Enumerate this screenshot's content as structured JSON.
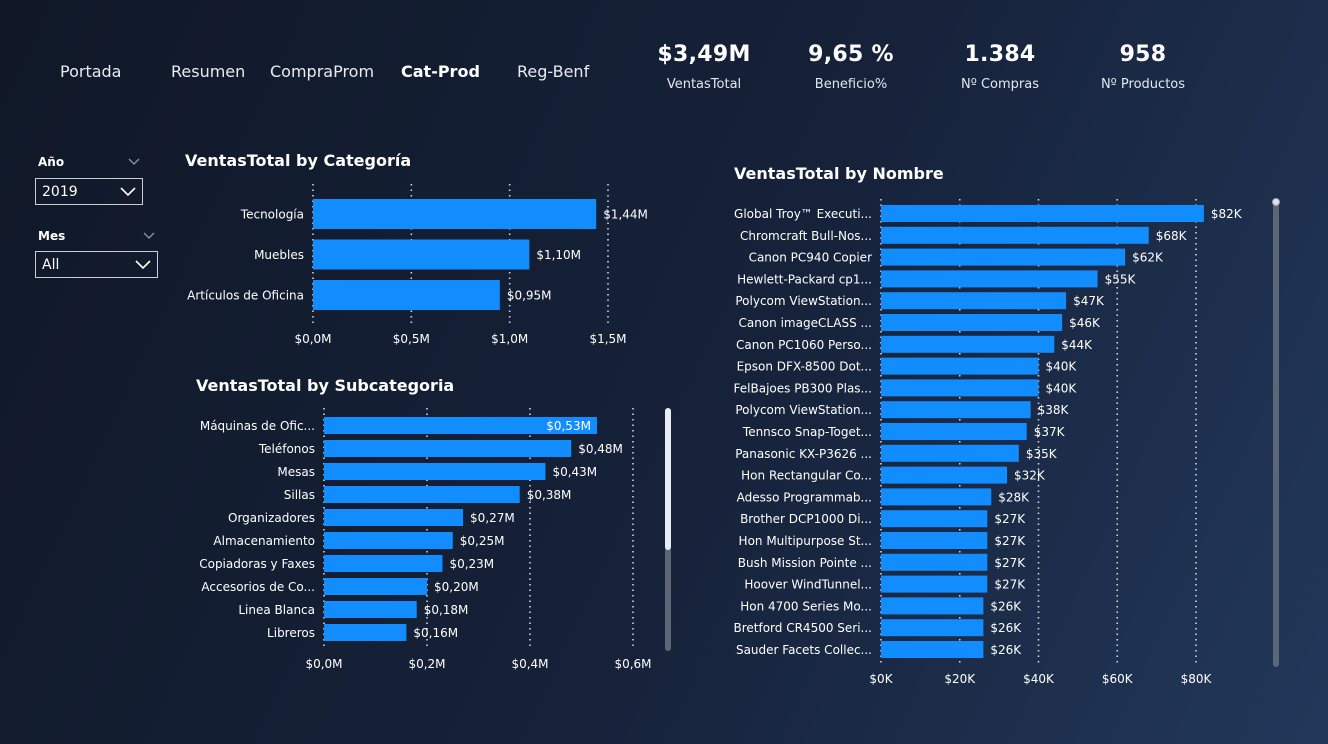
{
  "nav": {
    "items": [
      {
        "label": "Portada",
        "active": false
      },
      {
        "label": "Resumen",
        "active": false
      },
      {
        "label": "CompraProm",
        "active": false
      },
      {
        "label": "Cat-Prod",
        "active": true
      },
      {
        "label": "Reg-Benf",
        "active": false
      }
    ]
  },
  "kpis": [
    {
      "value": "$3,49M",
      "label": "VentasTotal"
    },
    {
      "value": "9,65 %",
      "label": "Beneficio%"
    },
    {
      "value": "1.384",
      "label": "Nº Compras"
    },
    {
      "value": "958",
      "label": "Nº Productos"
    }
  ],
  "slicers": {
    "year": {
      "title": "Año",
      "selected": "2019",
      "icon": "chevron-down-icon"
    },
    "month": {
      "title": "Mes",
      "selected": "All",
      "icon": "chevron-down-icon"
    }
  },
  "colors": {
    "bar": "#118dff",
    "grid": "#cfd6df",
    "text": "#ffffff"
  },
  "chart_data": [
    {
      "type": "bar",
      "orientation": "horizontal",
      "title": "VentasTotal by Categoría",
      "categories": [
        "Tecnología",
        "Muebles",
        "Artículos de Oficina"
      ],
      "values": [
        1.44,
        1.1,
        0.95
      ],
      "value_labels": [
        "$1,44M",
        "$1,10M",
        "$0,95M"
      ],
      "xlim": [
        0,
        1.5
      ],
      "x_ticks": [
        0,
        0.5,
        1.0,
        1.5
      ],
      "x_tick_labels": [
        "$0,0M",
        "$0,5M",
        "$1,0M",
        "$1,5M"
      ],
      "unit": "M"
    },
    {
      "type": "bar",
      "orientation": "horizontal",
      "title": "VentasTotal by Subcategoria",
      "categories": [
        "Máquinas de Ofic...",
        "Teléfonos",
        "Mesas",
        "Sillas",
        "Organizadores",
        "Almacenamiento",
        "Copiadoras y Faxes",
        "Accesorios de Co...",
        "Linea Blanca",
        "Libreros"
      ],
      "values": [
        0.53,
        0.48,
        0.43,
        0.38,
        0.27,
        0.25,
        0.23,
        0.2,
        0.18,
        0.16
      ],
      "value_labels": [
        "$0,53M",
        "$0,48M",
        "$0,43M",
        "$0,38M",
        "$0,27M",
        "$0,25M",
        "$0,23M",
        "$0,20M",
        "$0,18M",
        "$0,16M"
      ],
      "xlim": [
        0,
        0.6
      ],
      "x_ticks": [
        0,
        0.2,
        0.4,
        0.6
      ],
      "x_tick_labels": [
        "$0,0M",
        "$0,2M",
        "$0,4M",
        "$0,6M"
      ],
      "unit": "M"
    },
    {
      "type": "bar",
      "orientation": "horizontal",
      "title": "VentasTotal by Nombre",
      "categories": [
        "Global Troy™ Executi...",
        "Chromcraft Bull-Nos...",
        "Canon PC940 Copier",
        "Hewlett-Packard cp1...",
        "Polycom ViewStation...",
        "Canon imageCLASS ...",
        "Canon PC1060 Perso...",
        "Epson DFX-8500 Dot...",
        "FelBajoes PB300 Plas...",
        "Polycom ViewStation...",
        "Tennsco Snap-Toget...",
        "Panasonic KX-P3626 ...",
        "Hon Rectangular Co...",
        "Adesso Programmab...",
        "Brother DCP1000 Di...",
        "Hon Multipurpose St...",
        "Bush Mission Pointe ...",
        "Hoover WindTunnel...",
        "Hon 4700 Series Mo...",
        "Bretford CR4500 Seri...",
        "Sauder Facets Collec..."
      ],
      "values": [
        82,
        68,
        62,
        55,
        47,
        46,
        44,
        40,
        40,
        38,
        37,
        35,
        32,
        28,
        27,
        27,
        27,
        27,
        26,
        26,
        26
      ],
      "value_labels": [
        "$82K",
        "$68K",
        "$62K",
        "$55K",
        "$47K",
        "$46K",
        "$44K",
        "$40K",
        "$40K",
        "$38K",
        "$37K",
        "$35K",
        "$32K",
        "$28K",
        "$27K",
        "$27K",
        "$27K",
        "$27K",
        "$26K",
        "$26K",
        "$26K"
      ],
      "xlim": [
        0,
        80
      ],
      "x_ticks": [
        0,
        20,
        40,
        60,
        80
      ],
      "x_tick_labels": [
        "$0K",
        "$20K",
        "$40K",
        "$60K",
        "$80K"
      ],
      "unit": "K"
    }
  ]
}
